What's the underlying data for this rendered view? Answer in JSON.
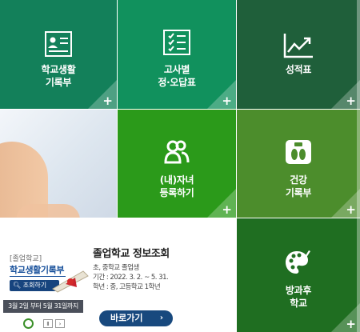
{
  "tiles": {
    "school_record": {
      "label1": "학교생활",
      "label2": "기록부",
      "plus": "+"
    },
    "exam": {
      "label1": "고사별",
      "label2": "정·오답표",
      "plus": "+"
    },
    "grades": {
      "label1": "성적표",
      "plus": "+"
    },
    "child": {
      "label1": "(내)자녀",
      "label2": "등록하기",
      "plus": "+"
    },
    "health": {
      "label1": "건강",
      "label2": "기록부",
      "plus": "+"
    },
    "afterschool": {
      "label1": "방과후",
      "label2": "학교",
      "plus": "+"
    }
  },
  "banner": {
    "category": "[졸업학교]",
    "record_title": "학교생활기록부",
    "view_button": "조회하기",
    "period": "3월 2일 부터 5월 31일까지"
  },
  "graduate": {
    "title": "졸업학교 정보조회",
    "line1": "초, 중학교 졸업생",
    "line2": "기간 : 2022. 3. 2. ~ 5. 31.",
    "line3": "학년 : 중, 고등학교 1학년",
    "go_button": "바로가기",
    "go_arrow": "›"
  },
  "slider": {
    "pause": "Ⅱ",
    "next": "›"
  },
  "colors": {
    "green_dark": "#1f5f3a",
    "green": "#13805a",
    "navy": "#18497e"
  }
}
